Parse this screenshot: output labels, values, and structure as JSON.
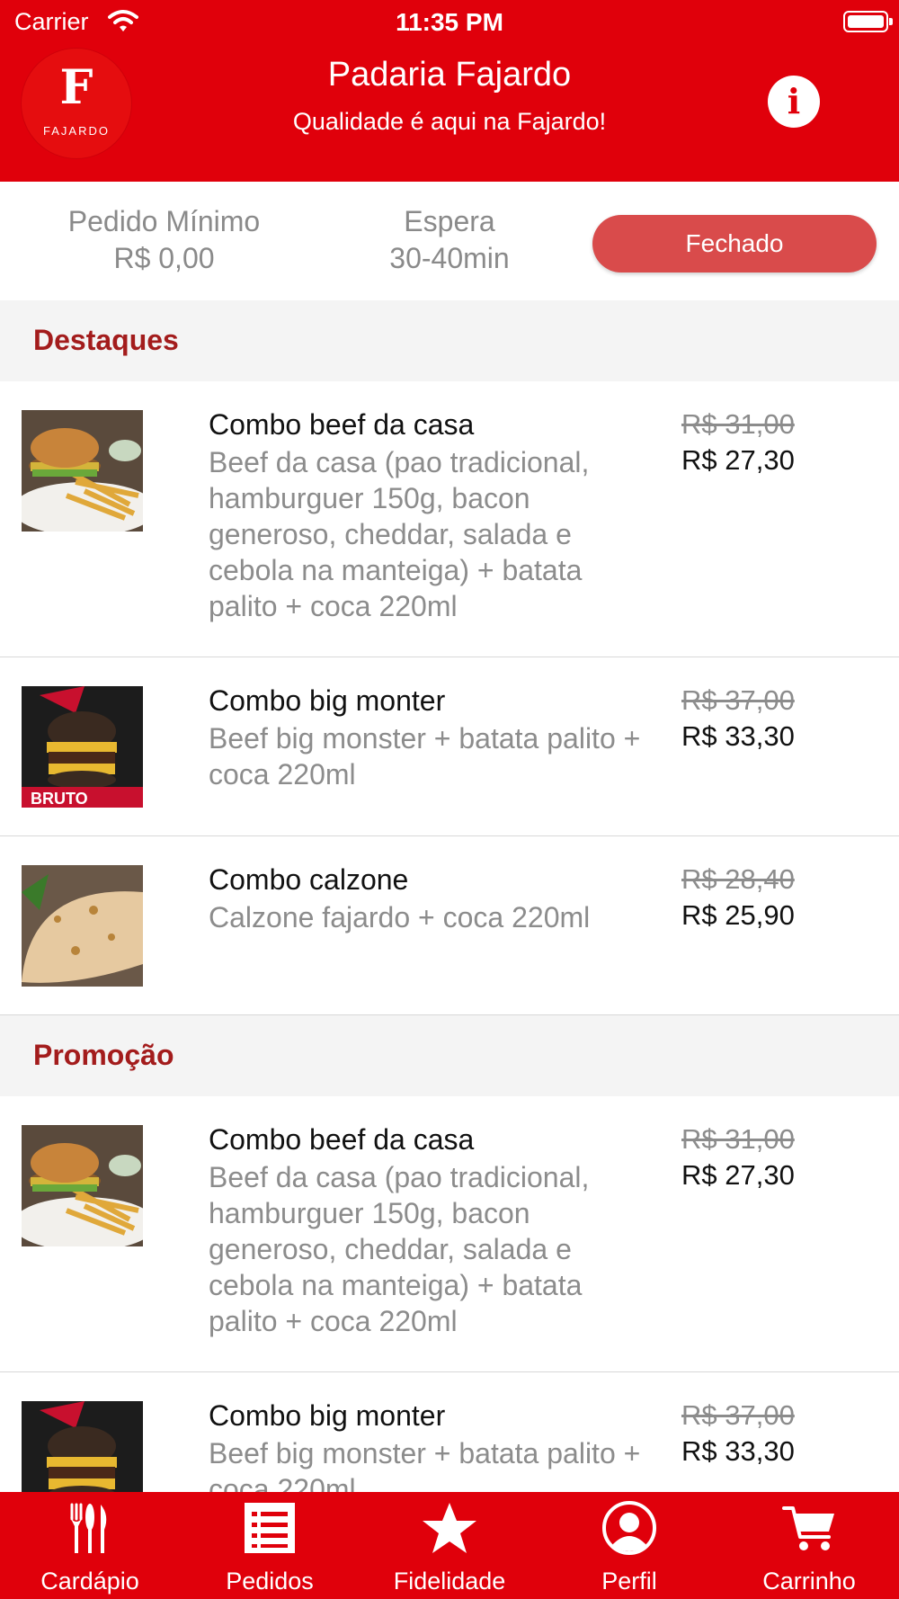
{
  "status_bar": {
    "carrier": "Carrier",
    "time": "11:35 PM"
  },
  "header": {
    "logo_text": "FAJARDO",
    "title": "Padaria Fajardo",
    "subtitle": "Qualidade é aqui na Fajardo!"
  },
  "info": {
    "min_order_label": "Pedido Mínimo",
    "min_order_value": "R$ 0,00",
    "wait_label": "Espera",
    "wait_value": "30-40min",
    "status": "Fechado"
  },
  "sections": [
    {
      "title": "Destaques",
      "items": [
        {
          "name": "Combo beef da casa",
          "description": "Beef da casa (pao tradicional, hamburguer 150g,  bacon generoso,  cheddar,  salada e cebola na manteiga)  + batata palito + coca 220ml",
          "old_price": "R$ 31,00",
          "price": "R$ 27,30",
          "image": "burger-fries-photo"
        },
        {
          "name": "Combo big monter",
          "description": "Beef big monster + batata palito + coca 220ml",
          "old_price": "R$ 37,00",
          "price": "R$ 33,30",
          "image": "big-monster-burger-poster"
        },
        {
          "name": "Combo calzone",
          "description": "Calzone fajardo + coca 220ml",
          "old_price": "R$ 28,40",
          "price": "R$ 25,90",
          "image": "calzone-photo"
        }
      ]
    },
    {
      "title": "Promoção",
      "items": [
        {
          "name": "Combo beef da casa",
          "description": "Beef da casa (pao tradicional, hamburguer 150g,  bacon generoso,  cheddar,  salada e cebola na manteiga)  + batata palito + coca 220ml",
          "old_price": "R$ 31,00",
          "price": "R$ 27,30",
          "image": "burger-fries-photo"
        },
        {
          "name": "Combo big monter",
          "description": "Beef big monster + batata palito + coca 220ml",
          "old_price": "R$ 37,00",
          "price": "R$ 33,30",
          "image": "big-monster-burger-poster"
        }
      ]
    }
  ],
  "tabs": [
    {
      "label": "Cardápio",
      "icon": "fork-knife-icon"
    },
    {
      "label": "Pedidos",
      "icon": "list-icon"
    },
    {
      "label": "Fidelidade",
      "icon": "star-icon"
    },
    {
      "label": "Perfil",
      "icon": "profile-icon"
    },
    {
      "label": "Carrinho",
      "icon": "cart-icon"
    }
  ],
  "colors": {
    "brand_red": "#e0000b",
    "section_title": "#a31c1c",
    "status_button": "#d94b4b",
    "muted_text": "#8c8c8c"
  }
}
